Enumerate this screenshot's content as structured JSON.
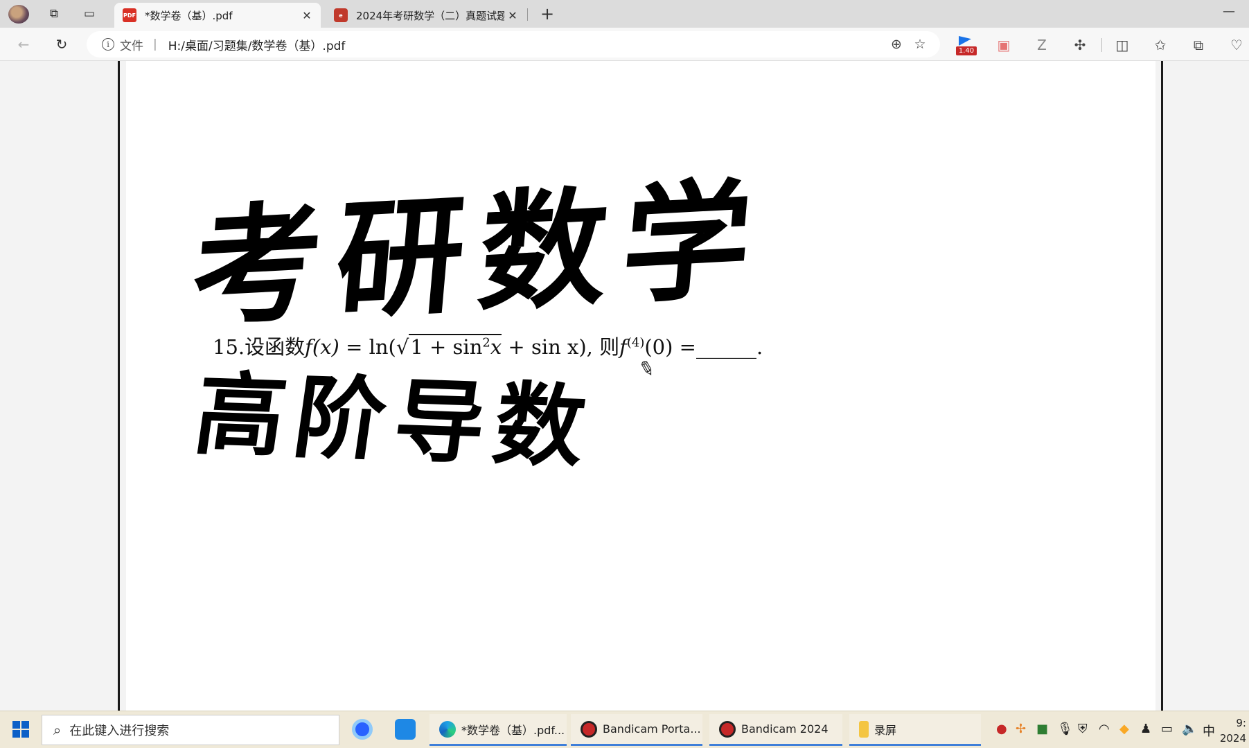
{
  "browser": {
    "tabs": [
      {
        "title": "*数学卷（基）.pdf",
        "close": "✕",
        "favicon": "pdf-icon"
      },
      {
        "title": "2024年考研数学（二）真题试题",
        "close": "✕",
        "favicon": "pdf-app-icon"
      }
    ],
    "new_tab": "+",
    "minimize": "—"
  },
  "address_bar": {
    "info": "i",
    "file_label": "文件",
    "separator": "|",
    "url": "H:/桌面/习题集/数学卷（基）.pdf",
    "extension_badge": "1.40"
  },
  "document": {
    "handwriting_line1": "考研数学",
    "handwriting_line2": "高阶导数",
    "problem": {
      "number": "15.",
      "lead": "设函数",
      "fx": "f(x)",
      "eq": " = ln(",
      "sqrt_sym": "√",
      "radicand_a": "1 + sin",
      "sq": "2",
      "radicand_b": "x",
      "tail": " + sin x), 则",
      "f4": "f",
      "order": "(4)",
      "at": "(0) =",
      "blank": "______."
    }
  },
  "taskbar": {
    "search_placeholder": "在此键入进行搜索",
    "apps": [
      {
        "label": "*数学卷（基）.pdf..."
      },
      {
        "label": "Bandicam Porta..."
      },
      {
        "label": "Bandicam 2024"
      },
      {
        "label": "录屏"
      }
    ],
    "ime": "中",
    "time": "9:",
    "date": "2024"
  },
  "colors": {
    "accent": "#3f7fd9",
    "pdf_red": "#d93025",
    "taskbar_bg": "#efe9d8"
  }
}
